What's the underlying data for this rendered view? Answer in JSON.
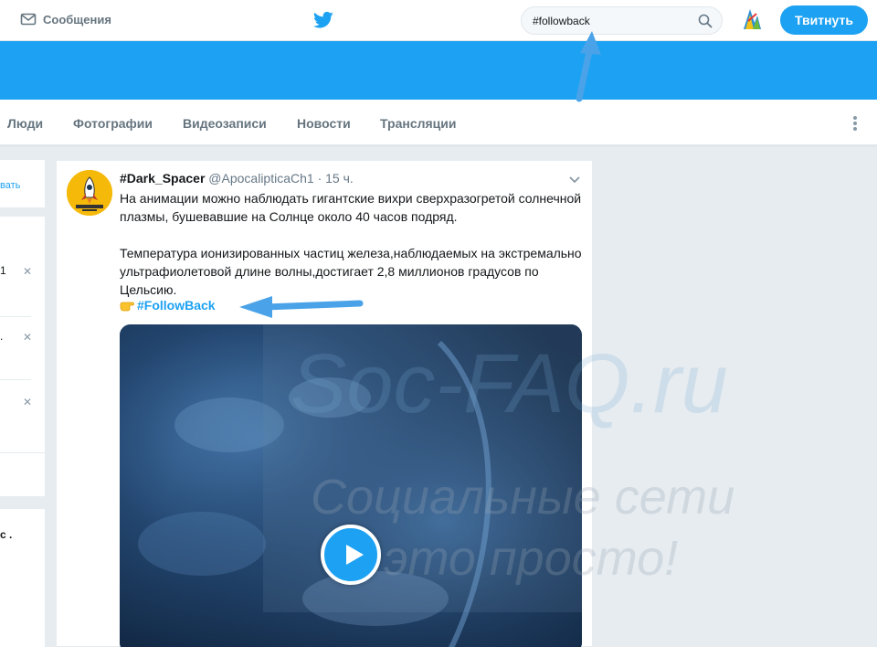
{
  "topbar": {
    "messages_label": "Сообщения",
    "search_value": "#followback",
    "tweet_button": "Твитнуть"
  },
  "tabs": [
    "Люди",
    "Фотографии",
    "Видеозаписи",
    "Новости",
    "Трансляции"
  ],
  "left_column": {
    "link_fragment": "вать",
    "line_frag_1": "1",
    "line_frag_2": ".",
    "line_frag_3": "с ."
  },
  "tweet": {
    "name": "#Dark_Spacer",
    "handle": "@ApocalipticaCh1",
    "time": "· 15 ч.",
    "paragraph1": "На анимации можно наблюдать гигантские вихри сверхразогретой солнечной плазмы, бушевавшие на Солнце около 40 часов подряд.",
    "paragraph2": "Температура ионизированных частиц железа,наблюдаемых на экстремально ультрафиолетовой длине волны,достигает 2,8 миллионов градусов по Цельсию.",
    "hashtag": "#FollowBack"
  },
  "watermark": {
    "line1": "Soc-FAQ.ru",
    "line2": "Социальные сети",
    "line3": "это просто!"
  },
  "colors": {
    "accent": "#1da1f2",
    "background": "#e6ecf0",
    "secondary_text": "#657786"
  }
}
